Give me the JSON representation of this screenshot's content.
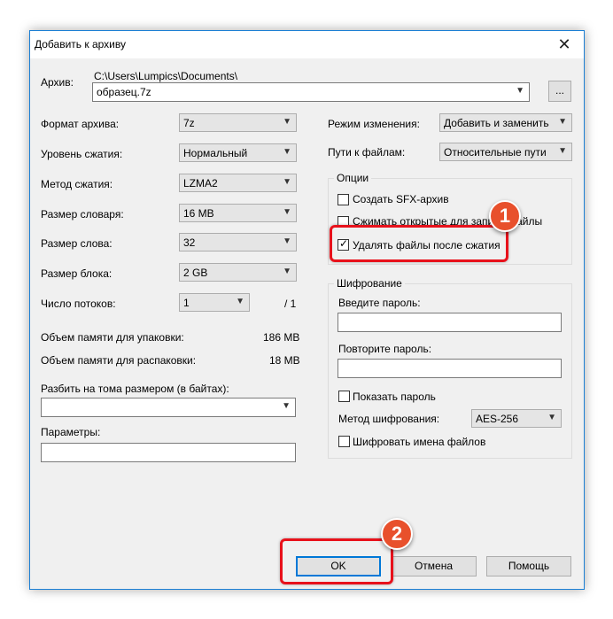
{
  "window": {
    "title": "Добавить к архиву",
    "close_glyph": "✕"
  },
  "archive": {
    "label": "Архив:",
    "path": "C:\\Users\\Lumpics\\Documents\\",
    "filename": "образец.7z",
    "browse_label": "..."
  },
  "left": {
    "format_label": "Формат архива:",
    "format_value": "7z",
    "level_label": "Уровень сжатия:",
    "level_value": "Нормальный",
    "method_label": "Метод сжатия:",
    "method_value": "LZMA2",
    "dict_label": "Размер словаря:",
    "dict_value": "16 MB",
    "word_label": "Размер слова:",
    "word_value": "32",
    "block_label": "Размер блока:",
    "block_value": "2 GB",
    "threads_label": "Число потоков:",
    "threads_value": "1",
    "threads_total": "/ 1",
    "mem_pack_label": "Объем памяти для упаковки:",
    "mem_pack_value": "186 MB",
    "mem_unpack_label": "Объем памяти для распаковки:",
    "mem_unpack_value": "18 MB",
    "split_label": "Разбить на тома размером (в байтах):",
    "split_value": "",
    "params_label": "Параметры:",
    "params_value": ""
  },
  "right": {
    "mode_label": "Режим изменения:",
    "mode_value": "Добавить и заменить",
    "paths_label": "Пути к файлам:",
    "paths_value": "Относительные пути",
    "options_title": "Опции",
    "options": [
      {
        "label": "Создать SFX-архив",
        "checked": false
      },
      {
        "label": "Сжимать открытые для записи файлы",
        "checked": false
      },
      {
        "label": "Удалять файлы после сжатия",
        "checked": true
      }
    ],
    "enc_title": "Шифрование",
    "pwd_label": "Введите пароль:",
    "pwd2_label": "Повторите пароль:",
    "show_pwd_label": "Показать пароль",
    "enc_method_label": "Метод шифрования:",
    "enc_method_value": "AES-256",
    "enc_names_label": "Шифровать имена файлов"
  },
  "buttons": {
    "ok": "OK",
    "cancel": "Отмена",
    "help": "Помощь"
  },
  "annotations": {
    "badge1": "1",
    "badge2": "2"
  },
  "colors": {
    "highlight": "#e8111b",
    "badge": "#e8502c",
    "accent": "#0078d7"
  }
}
